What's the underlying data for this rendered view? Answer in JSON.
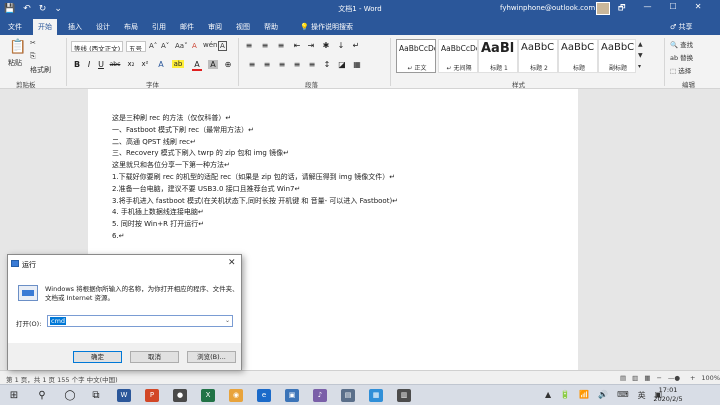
{
  "titlebar": {
    "qat": [
      "💾",
      "↶",
      "↻",
      "⌄"
    ],
    "title": "文档1 - Word",
    "account": "fyhwinphone@outlook.com",
    "win_buttons": [
      "🗗",
      "—",
      "☐",
      "✕"
    ]
  },
  "tabs": {
    "items": [
      "文件",
      "开始",
      "插入",
      "设计",
      "布局",
      "引用",
      "邮件",
      "审阅",
      "视图",
      "帮助"
    ],
    "tellme": "💡 操作说明搜索",
    "share": "♂ 共享"
  },
  "ribbon": {
    "clipboard": {
      "label": "剪贴板",
      "paste": "粘贴",
      "cut": "✂",
      "copy": "⎘",
      "format_painter": "格式刷"
    },
    "font": {
      "label": "字体",
      "font_name": "等线 (西文正文)",
      "font_size": "五号",
      "grow": "A˄",
      "shrink": "A˅",
      "case": "Aa˅",
      "clear": "A",
      "wen": "wén",
      "char_border": "A",
      "buttons": [
        "B",
        "I",
        "U",
        "abc",
        "x₂",
        "x²",
        "A",
        "ab",
        "A",
        "A",
        "⊕"
      ]
    },
    "paragraph": {
      "label": "段落",
      "row1": [
        "≡",
        "≡",
        "≡",
        "⇤",
        "⇥",
        "✱",
        "↓",
        "↵"
      ],
      "row2": [
        "≡",
        "≡",
        "≡",
        "≡",
        "≡",
        "↕",
        "◪",
        "▦"
      ]
    },
    "styles": {
      "label": "样式",
      "items": [
        {
          "sample": "AaBbCcDc",
          "name": "↵ 正文"
        },
        {
          "sample": "AaBbCcDc",
          "name": "↵ 无间隔"
        },
        {
          "sample": "AaBl",
          "name": "标题 1"
        },
        {
          "sample": "AaBbC",
          "name": "标题 2"
        },
        {
          "sample": "AaBbC",
          "name": "标题"
        },
        {
          "sample": "AaBbC",
          "name": "副标题"
        }
      ]
    },
    "editing": {
      "label": "编辑",
      "find": "🔍 查找",
      "replace": "ab 替换",
      "select": "⬚ 选择"
    }
  },
  "document": {
    "lines": [
      "这是三种刷 rec 的方法（仅仅科普）↵",
      "一、Fastboot 模式下刷 rec（最常用方法）↵",
      "二、高通 QPST 线刷 rec↵",
      "三、Recovery 模式下刷入 twrp 的 zip 包和 img 镜像↵",
      "这里就只和各位分享一下第一种方法↵",
      "1.下载好你要刷 rec 的机型的适配 rec（如果是 zip 包的话，请解压得到 img 镜像文件）↵",
      "2.准备一台电脑，建议不要 USB3.0 接口且推荐台式 Win7↵",
      "3.将手机进入 fastboot 模式(在关机状态下,同时长按 开机键 和 音量- 可以进入 Fastboot)↵",
      "4.  手机插上数据线连接电脑↵",
      "5.  同时按 Win+R 打开运行↵",
      "6.↵"
    ]
  },
  "statusbar": {
    "left": "第 1 页，共 1 页    155 个字    中文(中国)",
    "right": [
      "▤",
      "▥",
      "▦",
      "−",
      "—●—",
      "+",
      "100%"
    ]
  },
  "taskbar": {
    "icons": [
      "⊞",
      "⚲",
      "◯",
      "⧉"
    ],
    "apps": [
      {
        "label": "W",
        "color": "#2b579a"
      },
      {
        "label": "P",
        "color": "#d24726"
      },
      {
        "label": "●",
        "color": "#4a4a4a"
      },
      {
        "label": "X",
        "color": "#217346"
      },
      {
        "label": "◉",
        "color": "#e8a33c"
      },
      {
        "label": "e",
        "color": "#1b6ac9"
      },
      {
        "label": "▣",
        "color": "#3b74b8"
      },
      {
        "label": "♪",
        "color": "#7a5fa8"
      },
      {
        "label": "▤",
        "color": "#5a6f8a"
      },
      {
        "label": "▦",
        "color": "#2f8fd8"
      },
      {
        "label": "▥",
        "color": "#4c4c4c"
      }
    ],
    "tray": [
      "▲",
      "🔋",
      "📶",
      "🔊",
      "⌨",
      "英",
      "▣"
    ],
    "time": "17:01",
    "date": "2020/2/5"
  },
  "run_dialog": {
    "title": "运行",
    "close": "✕",
    "description": "Windows 将根据你所输入的名称，为你打开相应的程序、文件夹、文档或 Internet 资源。",
    "open_label": "打开(O):",
    "open_value": "cmd",
    "dropdown": "⌄",
    "ok": "确定",
    "cancel": "取消",
    "browse": "浏览(B)..."
  }
}
